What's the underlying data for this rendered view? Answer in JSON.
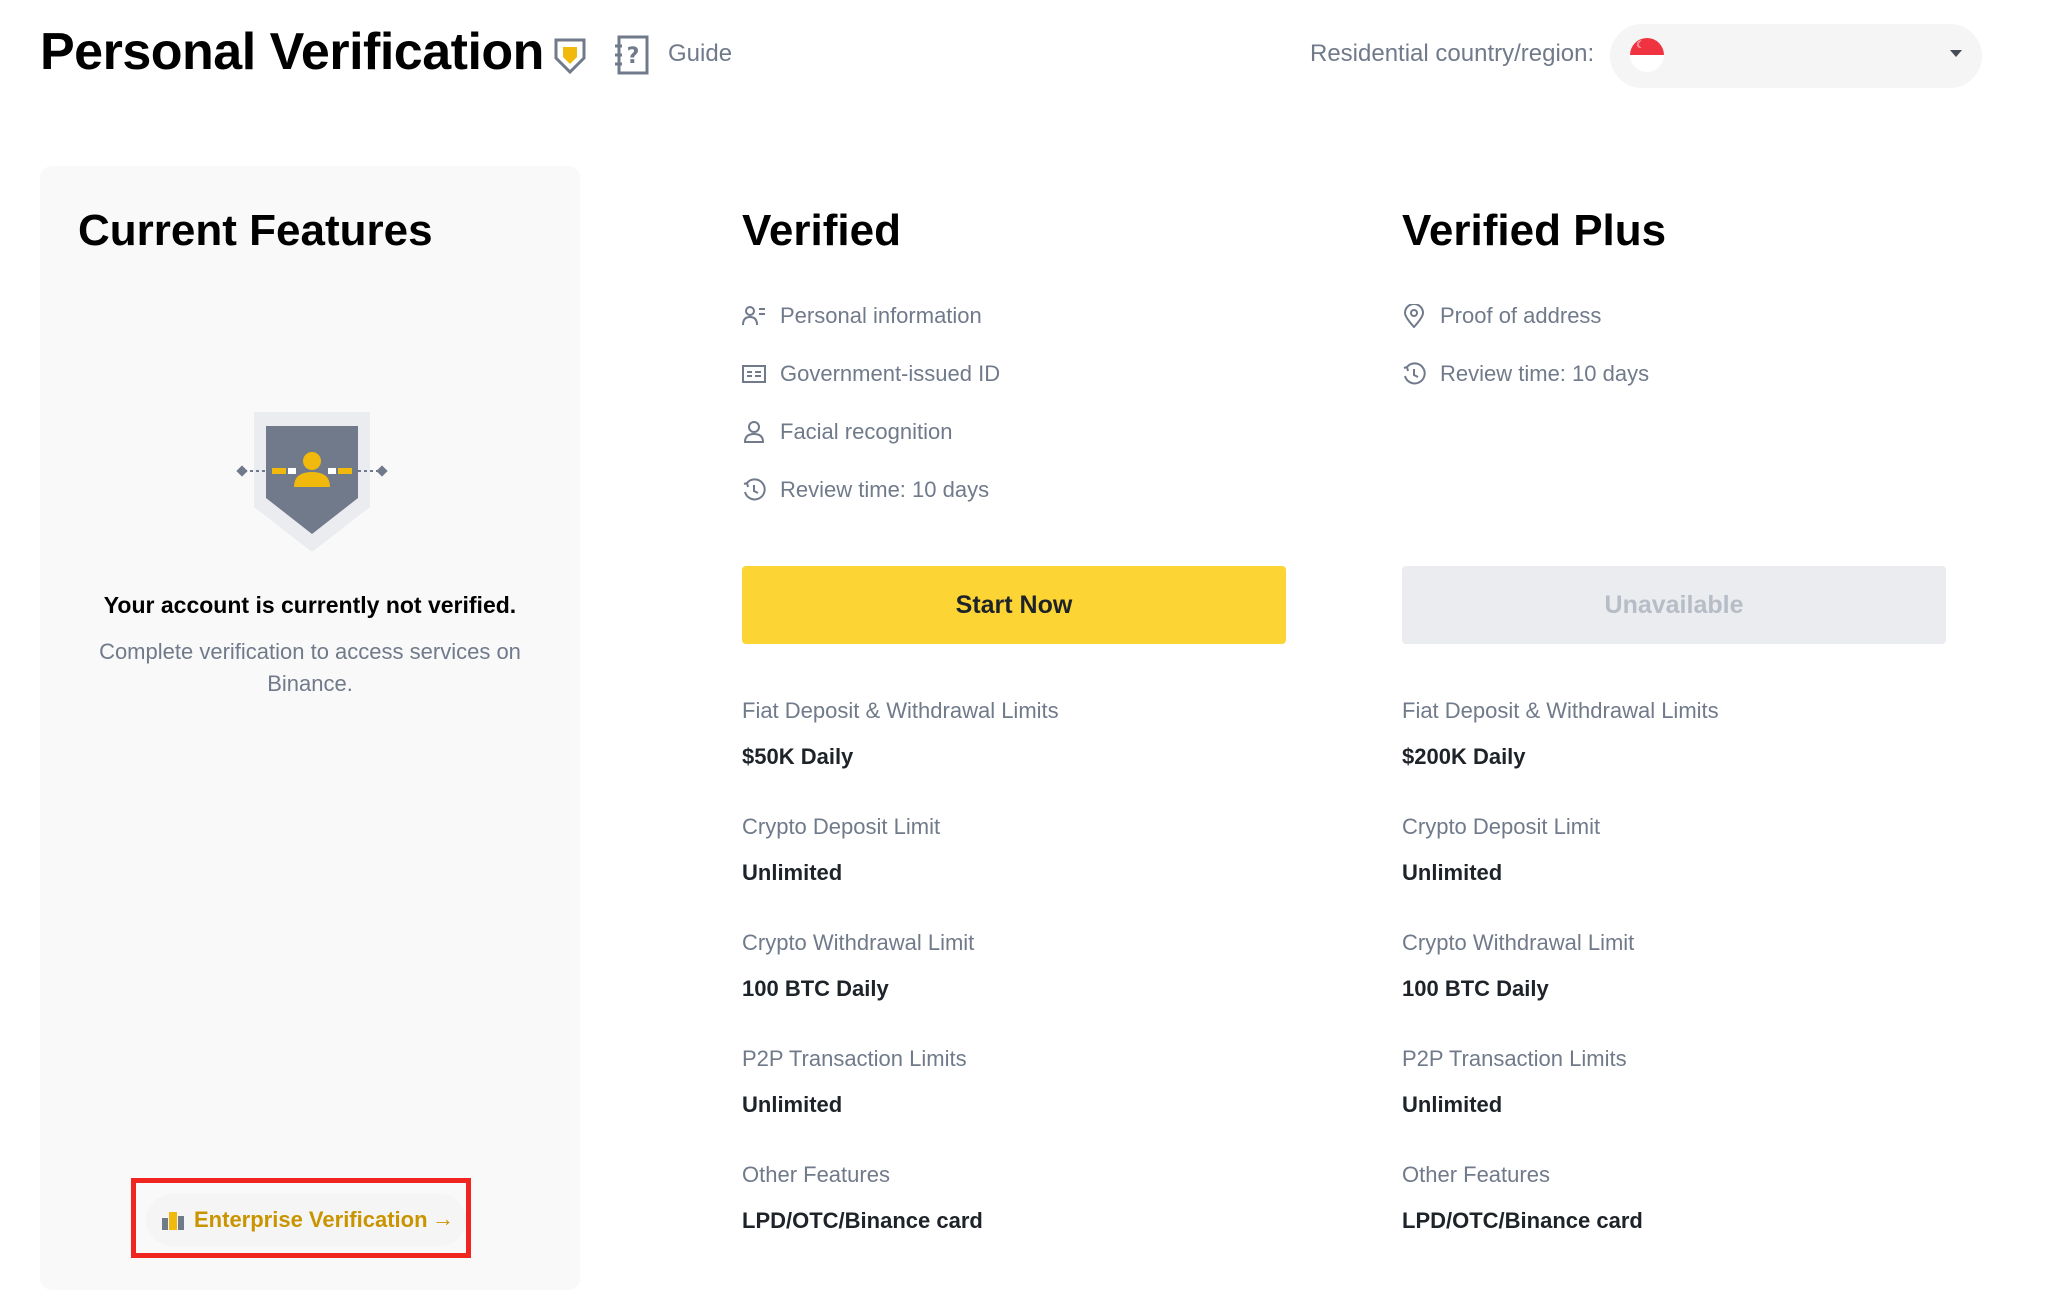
{
  "header": {
    "title": "Personal Verification",
    "guide_label": "Guide",
    "country_label": "Residential country/region:",
    "country_flag_icon": "singapore-flag-icon"
  },
  "current": {
    "title": "Current Features",
    "status_title": "Your account is currently not verified.",
    "status_desc": "Complete verification to access services on Binance.",
    "enterprise_label": "Enterprise Verification",
    "enterprise_arrow": "→"
  },
  "tiers": [
    {
      "title": "Verified",
      "requirements": [
        {
          "icon": "personal-info-icon",
          "label": "Personal information"
        },
        {
          "icon": "id-card-icon",
          "label": "Government-issued ID"
        },
        {
          "icon": "face-icon",
          "label": "Facial recognition"
        },
        {
          "icon": "clock-icon",
          "label": "Review time: 10 days"
        }
      ],
      "button_label": "Start Now",
      "limits": [
        {
          "label": "Fiat Deposit & Withdrawal Limits",
          "value": "$50K Daily"
        },
        {
          "label": "Crypto Deposit Limit",
          "value": "Unlimited"
        },
        {
          "label": "Crypto Withdrawal Limit",
          "value": "100 BTC Daily"
        },
        {
          "label": "P2P Transaction Limits",
          "value": "Unlimited"
        },
        {
          "label": "Other Features",
          "value": "LPD/OTC/Binance card"
        }
      ]
    },
    {
      "title": "Verified Plus",
      "requirements": [
        {
          "icon": "location-icon",
          "label": "Proof of address"
        },
        {
          "icon": "clock-icon",
          "label": "Review time: 10 days"
        }
      ],
      "button_label": "Unavailable",
      "limits": [
        {
          "label": "Fiat Deposit & Withdrawal Limits",
          "value": "$200K Daily"
        },
        {
          "label": "Crypto Deposit Limit",
          "value": "Unlimited"
        },
        {
          "label": "Crypto Withdrawal Limit",
          "value": "100 BTC Daily"
        },
        {
          "label": "P2P Transaction Limits",
          "value": "Unlimited"
        },
        {
          "label": "Other Features",
          "value": "LPD/OTC/Binance card"
        }
      ]
    }
  ],
  "colors": {
    "accent_yellow": "#fcd535",
    "gold_text": "#c99400",
    "muted_text": "#707a8a",
    "highlight_red": "#f0251f"
  }
}
